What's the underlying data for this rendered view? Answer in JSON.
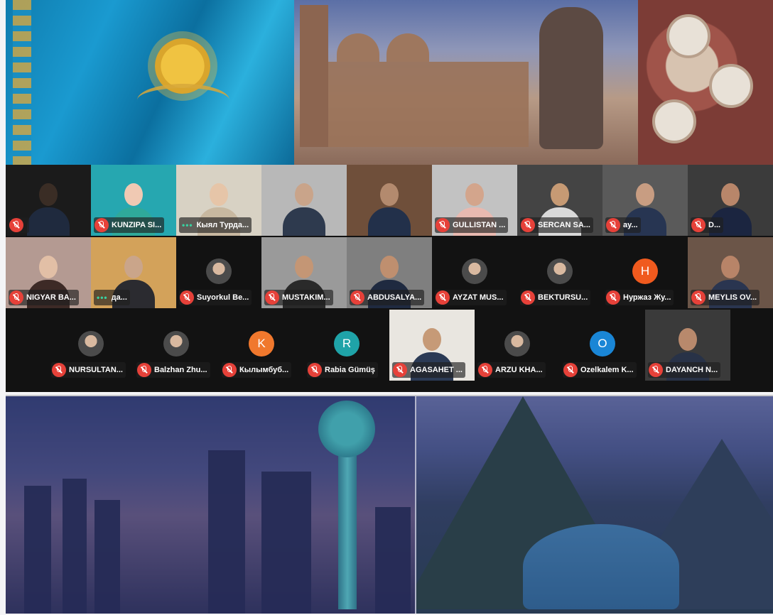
{
  "colors": {
    "mic_muted": "#e64139",
    "grid_bg": "#121212",
    "speaking_dots": "#39d0a0"
  },
  "participants": [
    {
      "id": "p1",
      "name": "",
      "mic": "muted-icon",
      "view": "video"
    },
    {
      "id": "p2",
      "name": "KUNZIPA SI...",
      "mic": "muted-icon",
      "view": "video"
    },
    {
      "id": "p3",
      "name": "Кыял Турда...",
      "mic": "speaking-dots-icon",
      "view": "video"
    },
    {
      "id": "p4",
      "name": "",
      "mic": "none",
      "view": "video"
    },
    {
      "id": "p5",
      "name": "",
      "mic": "none",
      "view": "video"
    },
    {
      "id": "p6",
      "name": "GULLISTAN ...",
      "mic": "muted-icon",
      "view": "video"
    },
    {
      "id": "p7",
      "name": "SERCAN SA...",
      "mic": "muted-icon",
      "view": "video"
    },
    {
      "id": "p8",
      "name": "ay...",
      "mic": "muted-icon",
      "view": "video"
    },
    {
      "id": "p9",
      "name": "D...",
      "mic": "muted-icon",
      "view": "video"
    },
    {
      "id": "p10",
      "name": "NIGYAR BA...",
      "mic": "muted-icon",
      "view": "video"
    },
    {
      "id": "p11",
      "name": "да...",
      "mic": "speaking-dots-icon",
      "view": "video"
    },
    {
      "id": "p12",
      "name": "Suyorkul Be...",
      "mic": "muted-icon",
      "view": "avatar-photo"
    },
    {
      "id": "p13",
      "name": "MUSTAKIM...",
      "mic": "muted-icon",
      "view": "video"
    },
    {
      "id": "p14",
      "name": "ABDUSALYA...",
      "mic": "muted-icon",
      "view": "video"
    },
    {
      "id": "p15",
      "name": "AYZAT MUS...",
      "mic": "muted-icon",
      "view": "avatar-photo"
    },
    {
      "id": "p16",
      "name": "BEKTURSU...",
      "mic": "muted-icon",
      "view": "avatar-photo"
    },
    {
      "id": "p17",
      "name": "Нуржаз Жу...",
      "mic": "muted-icon",
      "view": "avatar",
      "initial": "H",
      "avatar_color": "#f05a1e"
    },
    {
      "id": "p18",
      "name": "MEYLIS OV...",
      "mic": "muted-icon",
      "view": "video"
    },
    {
      "id": "p19",
      "name": "NURSULTAN...",
      "mic": "muted-icon",
      "view": "avatar-photo"
    },
    {
      "id": "p20",
      "name": "Balzhan Zhu...",
      "mic": "muted-icon",
      "view": "avatar-photo"
    },
    {
      "id": "p21",
      "name": "Кылымбуб...",
      "mic": "muted-icon",
      "view": "avatar",
      "initial": "K",
      "avatar_color": "#f0782d"
    },
    {
      "id": "p22",
      "name": "Rabia Gümüş",
      "mic": "muted-icon",
      "view": "avatar",
      "initial": "R",
      "avatar_color": "#1fa3a8"
    },
    {
      "id": "p23",
      "name": "AGASAHET ...",
      "mic": "muted-icon",
      "view": "video"
    },
    {
      "id": "p24",
      "name": "ARZU KHA...",
      "mic": "muted-icon",
      "view": "avatar-photo"
    },
    {
      "id": "p25",
      "name": "Ozelkalem K...",
      "mic": "muted-icon",
      "view": "avatar",
      "initial": "O",
      "avatar_color": "#1a86d6"
    },
    {
      "id": "p26",
      "name": "DAYANCH N...",
      "mic": "muted-icon",
      "view": "video"
    }
  ]
}
